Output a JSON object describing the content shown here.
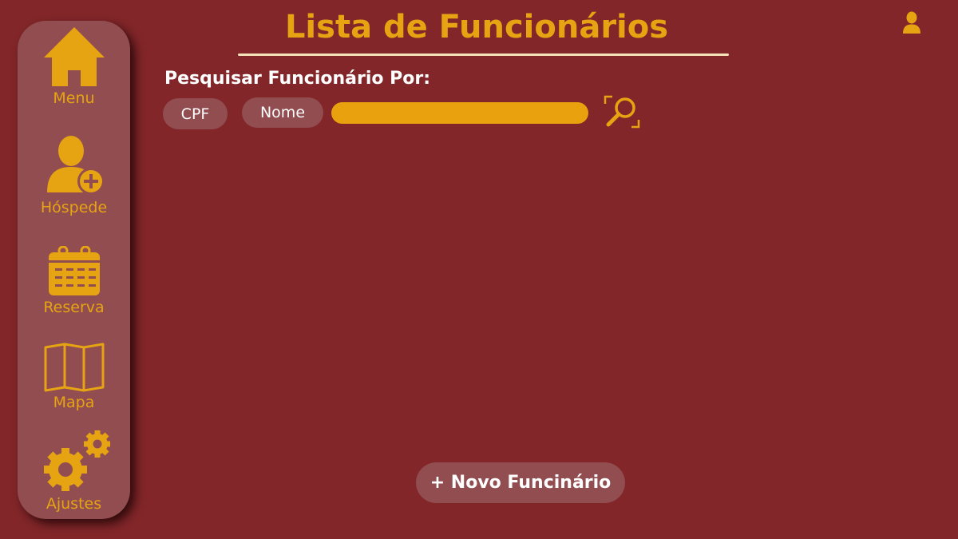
{
  "header": {
    "title": "Lista de Funcionários",
    "user_icon": "user-icon"
  },
  "sidebar": {
    "items": [
      {
        "label": "Menu",
        "icon": "home-icon"
      },
      {
        "label": "Hóspede",
        "icon": "add-user-icon"
      },
      {
        "label": "Reserva",
        "icon": "calendar-icon"
      },
      {
        "label": "Mapa",
        "icon": "map-icon"
      },
      {
        "label": "Ajustes",
        "icon": "gears-icon"
      }
    ]
  },
  "search": {
    "label": "Pesquisar Funcionário Por:",
    "options": [
      "CPF",
      "Nome"
    ],
    "value": "",
    "placeholder": "",
    "button_icon": "search-icon"
  },
  "actions": {
    "new_employee": "+ Novo Funcinário"
  },
  "colors": {
    "background": "#822629",
    "panel": "#914d50",
    "accent": "#e6a412",
    "text": "#ffffff"
  }
}
